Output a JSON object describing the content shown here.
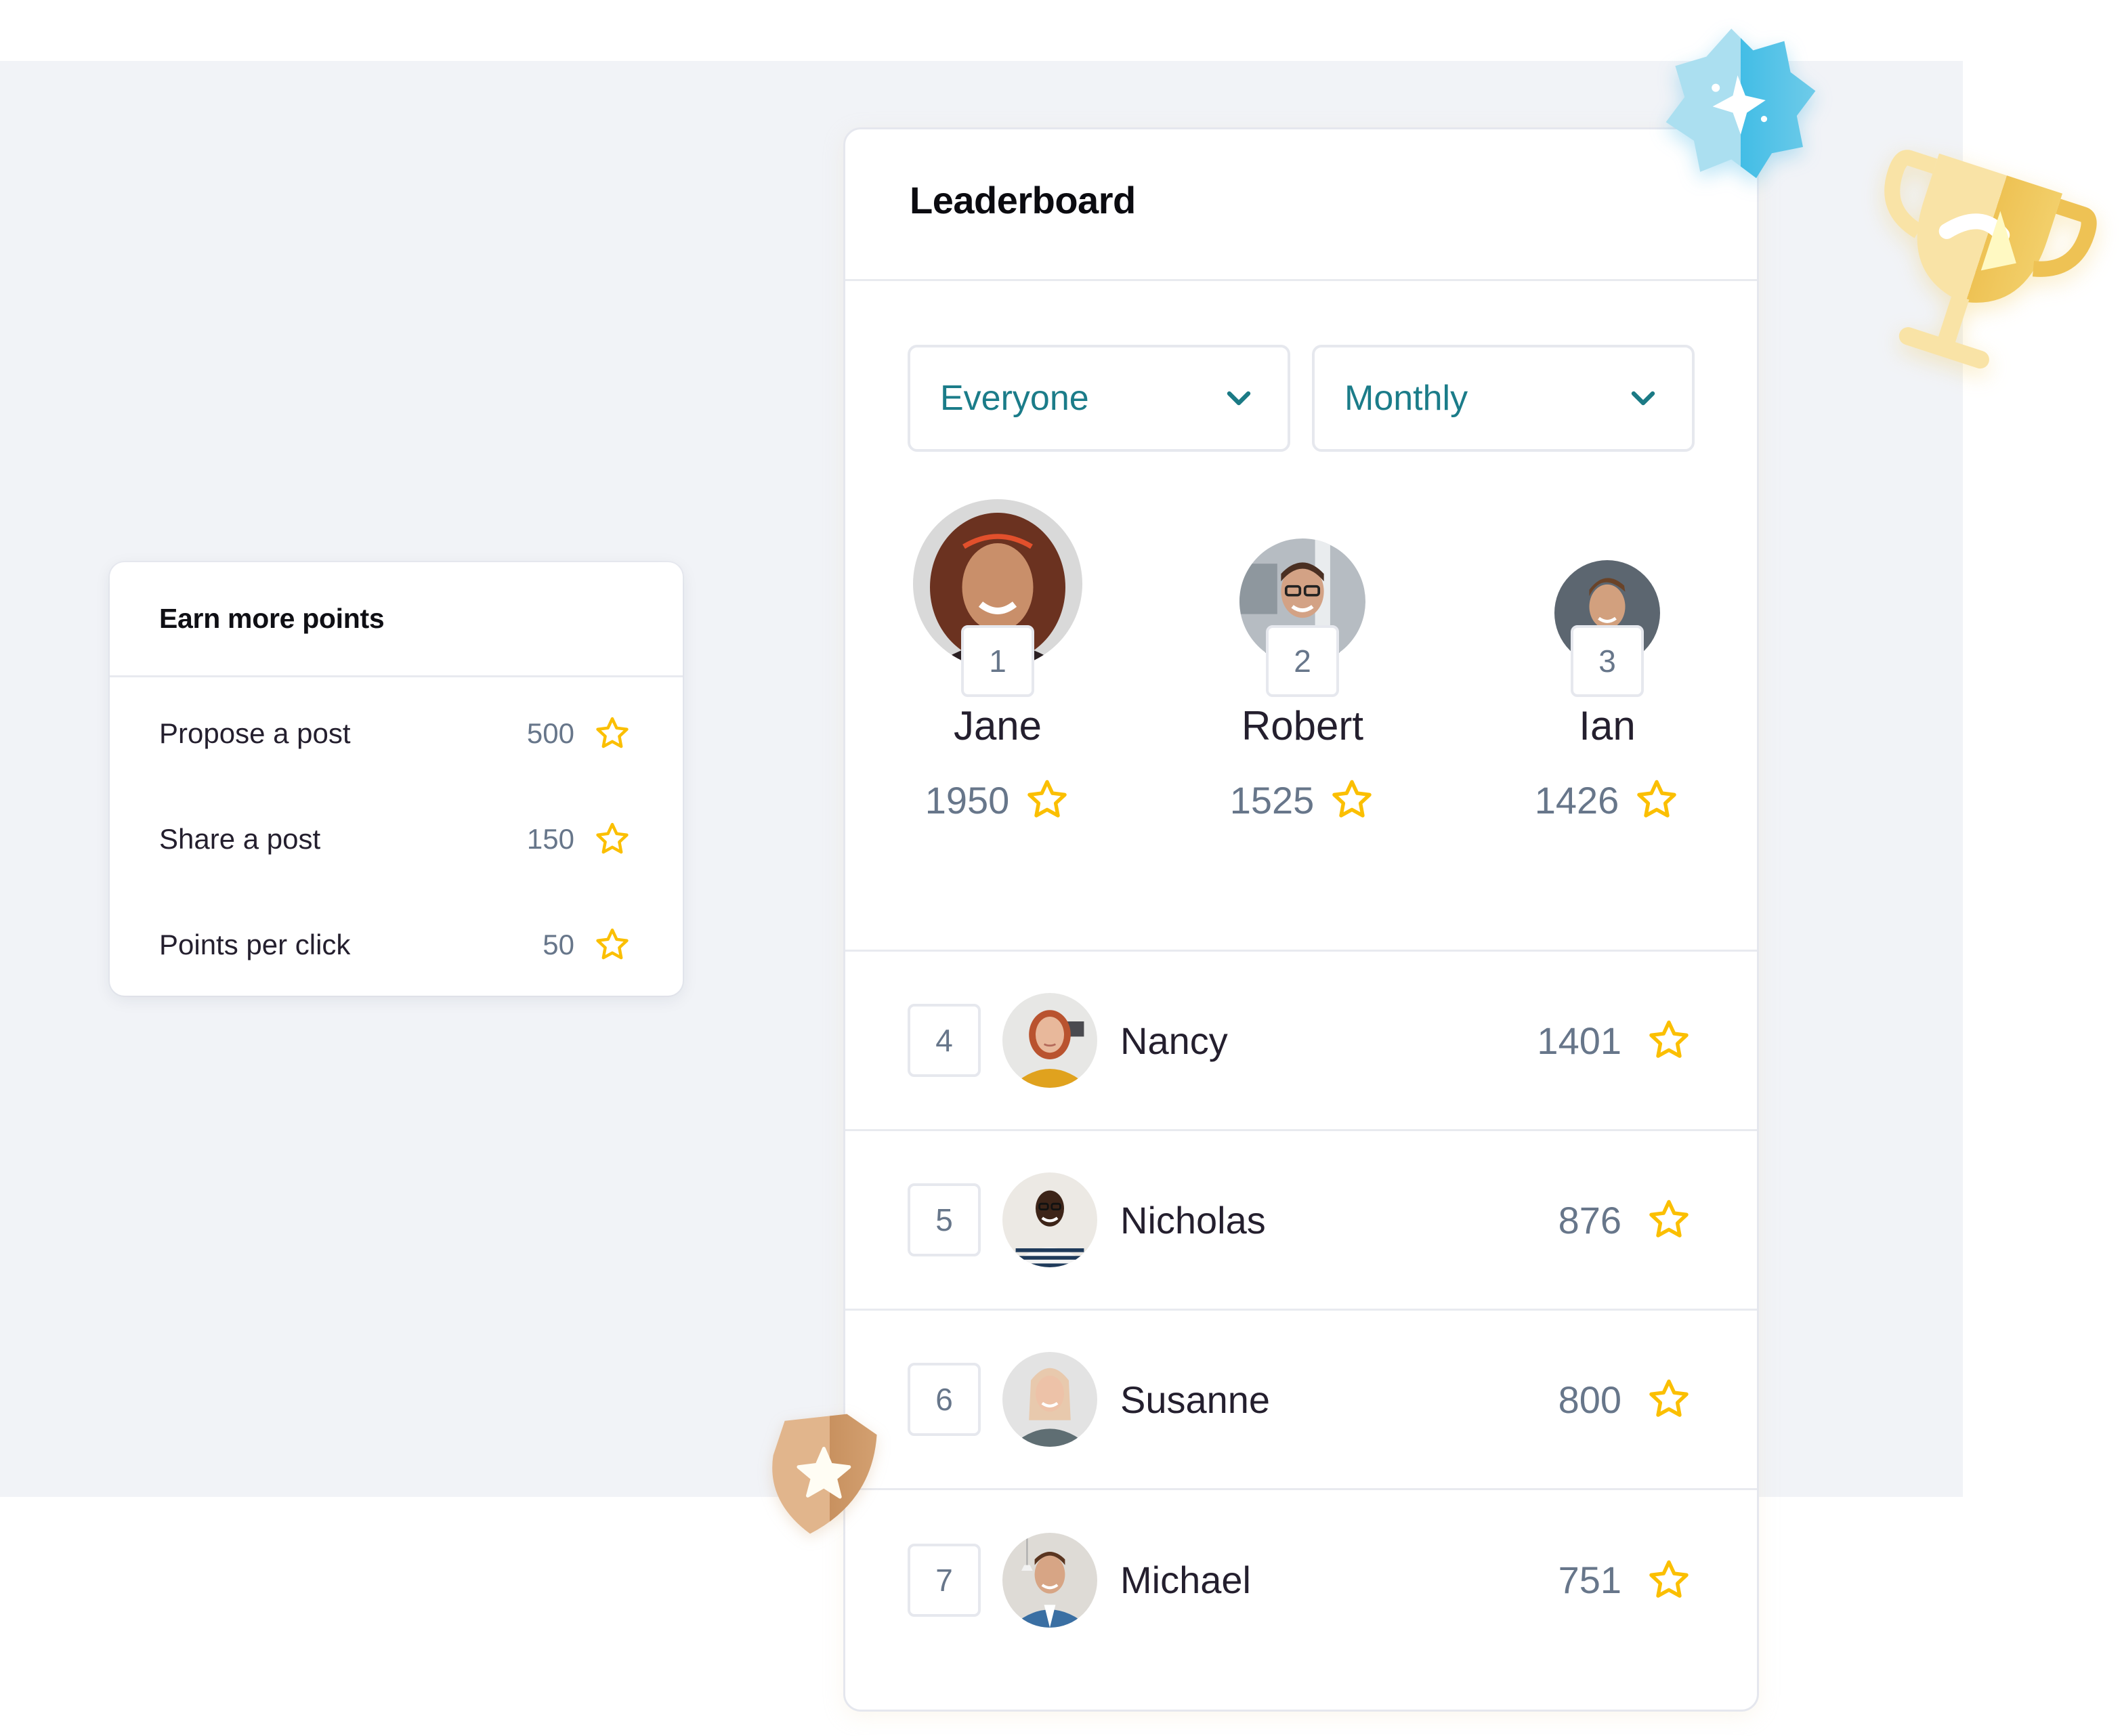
{
  "colors": {
    "background_panel": "#f1f3f7",
    "accent_teal": "#1b7c89",
    "star_gold": "#fbbf00",
    "score_gray": "#67768a",
    "text_dark": "#241f2e"
  },
  "earn_points": {
    "title": "Earn more points",
    "items": [
      {
        "label": "Propose a post",
        "points": "500",
        "icon": "star-icon"
      },
      {
        "label": "Share a post",
        "points": "150",
        "icon": "star-icon"
      },
      {
        "label": "Points per click",
        "points": "50",
        "icon": "star-icon"
      }
    ]
  },
  "leaderboard": {
    "title": "Leaderboard",
    "filters": {
      "audience": {
        "value": "Everyone",
        "icon": "chevron-down-icon"
      },
      "period": {
        "value": "Monthly",
        "icon": "chevron-down-icon"
      }
    },
    "podium": [
      {
        "rank": "1",
        "name": "Jane",
        "score": "1950",
        "avatar": "avatar-jane"
      },
      {
        "rank": "2",
        "name": "Robert",
        "score": "1525",
        "avatar": "avatar-robert"
      },
      {
        "rank": "3",
        "name": "Ian",
        "score": "1426",
        "avatar": "avatar-ian"
      }
    ],
    "rows": [
      {
        "rank": "4",
        "name": "Nancy",
        "score": "1401",
        "avatar": "avatar-nancy"
      },
      {
        "rank": "5",
        "name": "Nicholas",
        "score": "876",
        "avatar": "avatar-nicholas"
      },
      {
        "rank": "6",
        "name": "Susanne",
        "score": "800",
        "avatar": "avatar-susanne"
      },
      {
        "rank": "7",
        "name": "Michael",
        "score": "751",
        "avatar": "avatar-michael"
      }
    ]
  },
  "decorations": [
    "sparkle-badge-icon",
    "trophy-icon",
    "shield-star-icon"
  ]
}
